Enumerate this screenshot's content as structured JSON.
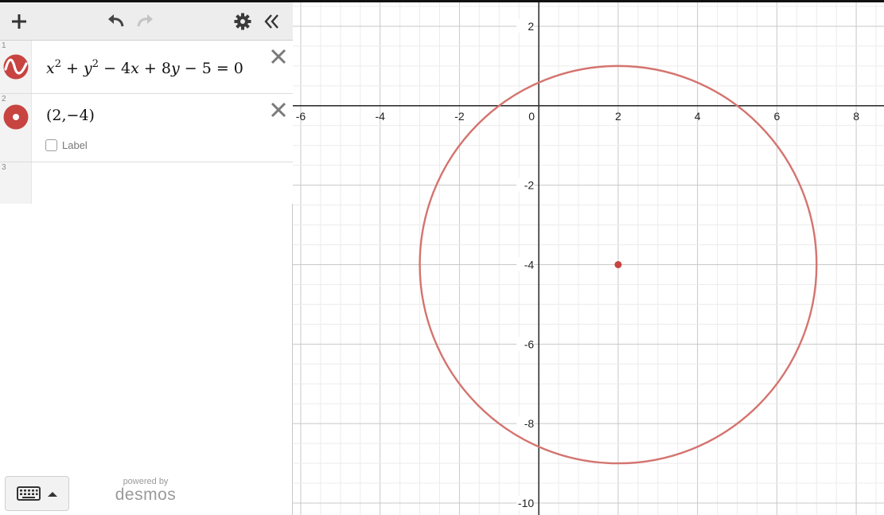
{
  "toolbar": {
    "add_icon": "plus-icon",
    "undo_icon": "undo-icon",
    "redo_icon": "redo-icon",
    "settings_icon": "gear-icon",
    "collapse_icon": "double-chevron-left-icon"
  },
  "expressions": [
    {
      "index": "1",
      "type": "equation",
      "icon": "wave-icon",
      "color": "#c74440",
      "latex_text": "x^2 + y^2 − 4x + 8y − 5 = 0",
      "parts": {
        "x": "x",
        "sq1": "2",
        "plus1": "+",
        "y": "y",
        "sq2": "2",
        "rest": "− 4",
        "x2": "x",
        "plus2": "+ 8",
        "y2": "y",
        "tail": "− 5 = 0"
      }
    },
    {
      "index": "2",
      "type": "point",
      "icon": "point-icon",
      "color": "#c74440",
      "latex_text": "(2,−4)",
      "label_checkbox_text": "Label"
    },
    {
      "index": "3",
      "type": "empty"
    }
  ],
  "footer": {
    "keyboard_icon": "keyboard-icon",
    "powered_by": "powered by",
    "brand": "desmos"
  },
  "graph": {
    "x_range": [
      -6.2,
      8.7
    ],
    "y_range": [
      -10.3,
      2.6
    ],
    "major_step": 2,
    "minor_step": 0.5,
    "x_tick_labels": [
      "-6",
      "-4",
      "-2",
      "0",
      "2",
      "4",
      "6",
      "8"
    ],
    "y_tick_labels": [
      "2",
      "-2",
      "-4",
      "-6",
      "-8",
      "-10"
    ],
    "circle": {
      "cx": 2,
      "cy": -4,
      "r": 5,
      "color": "#d4746f"
    },
    "point": {
      "x": 2,
      "y": -4,
      "color": "#c74440"
    }
  }
}
